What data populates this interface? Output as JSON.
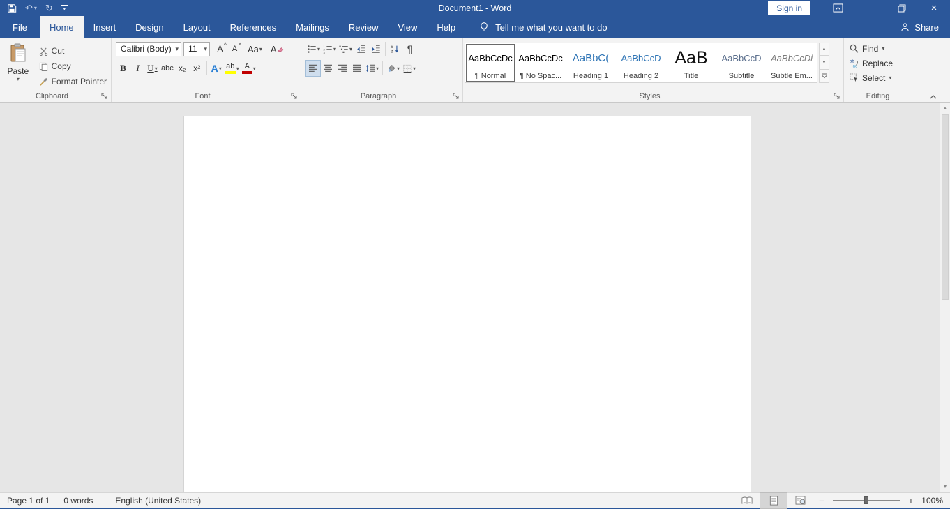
{
  "colors": {
    "accent": "#2b579a",
    "heading_blue": "#2e74b5",
    "font_color_red": "#c00000",
    "highlight_yellow": "#ffff00"
  },
  "title_bar": {
    "title": "Document1  -  Word",
    "sign_in": "Sign in"
  },
  "tabs": {
    "file": "File",
    "items": [
      "Home",
      "Insert",
      "Design",
      "Layout",
      "References",
      "Mailings",
      "Review",
      "View",
      "Help"
    ],
    "tell_me": "Tell me what you want to do",
    "share": "Share"
  },
  "ribbon": {
    "clipboard": {
      "label": "Clipboard",
      "paste": "Paste",
      "cut": "Cut",
      "copy": "Copy",
      "format_painter": "Format Painter"
    },
    "font": {
      "label": "Font",
      "family": "Calibri (Body)",
      "size": "11",
      "grow": "A",
      "shrink": "A",
      "change_case": "Aa",
      "clear": "A",
      "bold": "B",
      "italic": "I",
      "underline": "U",
      "strikethrough": "abc",
      "subscript": "x₂",
      "superscript": "x²",
      "text_effects": "A",
      "highlight": "ab",
      "font_color": "A"
    },
    "paragraph": {
      "label": "Paragraph",
      "pilcrow": "¶"
    },
    "styles": {
      "label": "Styles",
      "items": [
        {
          "preview": "AaBbCcDc",
          "name": "¶ Normal"
        },
        {
          "preview": "AaBbCcDc",
          "name": "¶ No Spac..."
        },
        {
          "preview": "AaBbC(",
          "name": "Heading 1"
        },
        {
          "preview": "AaBbCcD",
          "name": "Heading 2"
        },
        {
          "preview": "AaB",
          "name": "Title"
        },
        {
          "preview": "AaBbCcD",
          "name": "Subtitle"
        },
        {
          "preview": "AaBbCcDi",
          "name": "Subtle Em..."
        }
      ]
    },
    "editing": {
      "label": "Editing",
      "find": "Find",
      "replace": "Replace",
      "select": "Select"
    }
  },
  "status_bar": {
    "page": "Page 1 of 1",
    "words": "0 words",
    "language": "English (United States)",
    "zoom_out": "−",
    "zoom_in": "+",
    "zoom_level": "100%"
  }
}
